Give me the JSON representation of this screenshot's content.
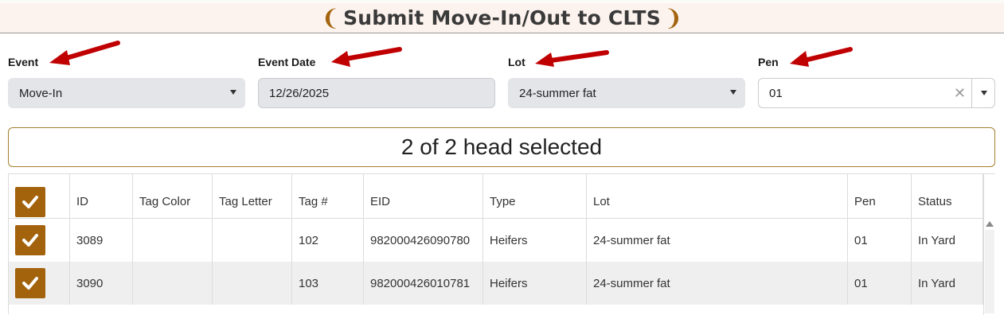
{
  "header": {
    "title": "Submit Move-In/Out to CLTS",
    "bracket_left": "❨",
    "bracket_right": "❩"
  },
  "form": {
    "event": {
      "label": "Event",
      "value": "Move-In"
    },
    "event_date": {
      "label": "Event Date",
      "value": "12/26/2025"
    },
    "lot": {
      "label": "Lot",
      "value": "24-summer fat"
    },
    "pen": {
      "label": "Pen",
      "value": "01",
      "clear_symbol": "✕"
    }
  },
  "selection_summary": "2 of 2 head selected",
  "table": {
    "columns": [
      "ID",
      "Tag Color",
      "Tag Letter",
      "Tag #",
      "EID",
      "Type",
      "Lot",
      "Pen",
      "Status"
    ],
    "rows": [
      {
        "id": "3089",
        "tag_color": "",
        "tag_letter": "",
        "tag_num": "102",
        "eid": "982000426090780",
        "type": "Heifers",
        "lot": "24-summer fat",
        "pen": "01",
        "status": "In Yard",
        "selected": true
      },
      {
        "id": "3090",
        "tag_color": "",
        "tag_letter": "",
        "tag_num": "103",
        "eid": "982000426010781",
        "type": "Heifers",
        "lot": "24-summer fat",
        "pen": "01",
        "status": "In Yard",
        "selected": true
      }
    ]
  },
  "colors": {
    "accent": "#a3620c",
    "annotation_arrow": "#c00000",
    "field_bg": "#e3e5e8"
  },
  "icons": {
    "checkbox": "check-icon",
    "dropdown": "chevron-down-icon",
    "clear": "close-icon",
    "annotation": "arrow-annotation-icon"
  }
}
